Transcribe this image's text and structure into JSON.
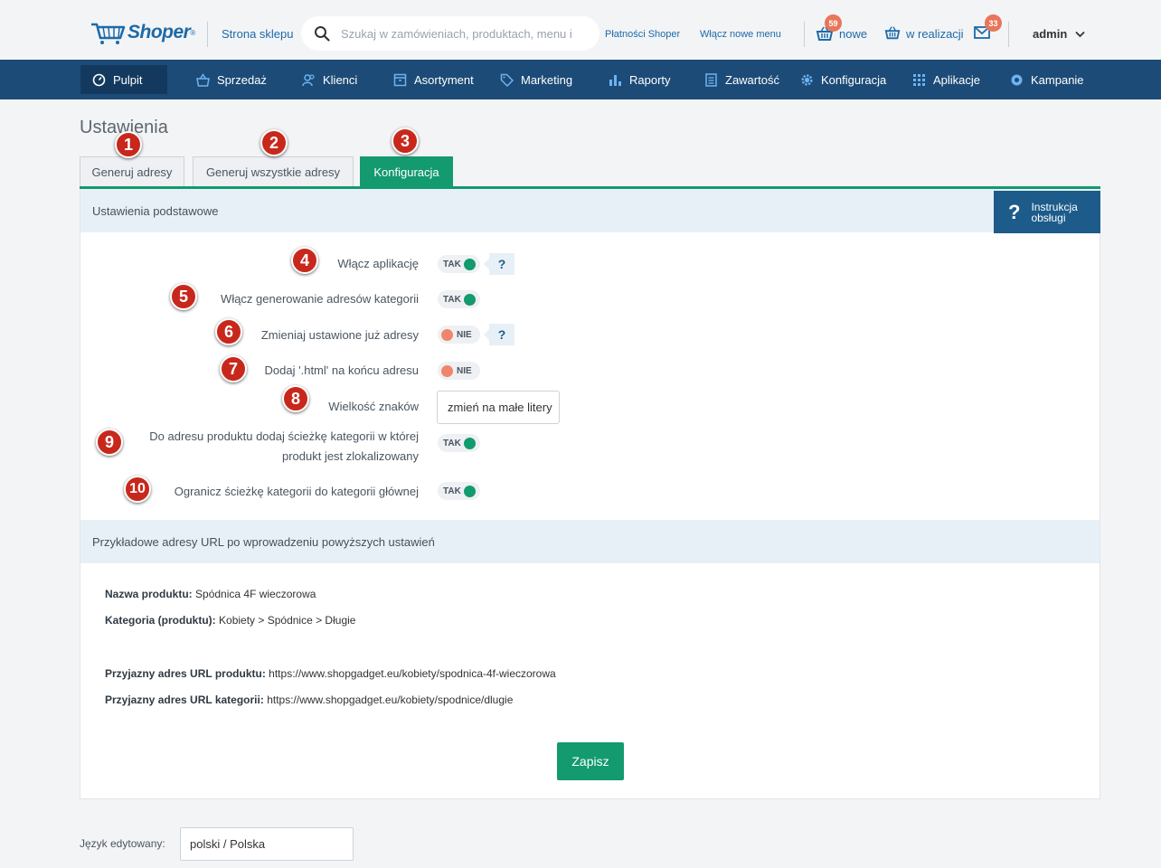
{
  "topbar": {
    "logo_text": "Shoper",
    "logo_reg": "®",
    "shop_link": "Strona sklepu",
    "search_placeholder": "Szukaj w zamówieniach, produktach, menu i",
    "payments_link": "Płatności Shoper",
    "new_menu_link": "Włącz nowe menu",
    "orders_new_count": "59",
    "orders_new_label": "nowe",
    "orders_progress_label": "w realizacji",
    "messages_count": "33",
    "user": "admin"
  },
  "nav": {
    "items": [
      {
        "label": "Pulpit",
        "icon": "dashboard-icon"
      },
      {
        "label": "Sprzedaż",
        "icon": "basket-icon"
      },
      {
        "label": "Klienci",
        "icon": "users-icon"
      },
      {
        "label": "Asortyment",
        "icon": "box-icon"
      },
      {
        "label": "Marketing",
        "icon": "tag-icon"
      },
      {
        "label": "Raporty",
        "icon": "chart-icon"
      },
      {
        "label": "Zawartość",
        "icon": "document-icon"
      },
      {
        "label": "Konfiguracja",
        "icon": "gear-icon"
      },
      {
        "label": "Aplikacje",
        "icon": "grid-icon"
      },
      {
        "label": "Kampanie",
        "icon": "campaign-icon"
      }
    ]
  },
  "page": {
    "title": "Ustawienia",
    "tabs": [
      "Generuj adresy",
      "Generuj wszystkie adresy",
      "Konfiguracja"
    ],
    "active_tab": "Konfiguracja"
  },
  "basic": {
    "header": "Ustawienia podstawowe",
    "help_line1": "Instrukcja",
    "help_line2": "obsługi",
    "help_q": "?",
    "rows": [
      {
        "label": "Włącz aplikację",
        "value": "TAK",
        "help": "?"
      },
      {
        "label": "Włącz generowanie adresów kategorii",
        "value": "TAK"
      },
      {
        "label": "Zmieniaj ustawione już adresy",
        "value": "NIE",
        "help": "?"
      },
      {
        "label": "Dodaj '.html' na końcu adresu",
        "value": "NIE"
      },
      {
        "label": "Wielkość znaków",
        "value": "zmień na małe litery"
      },
      {
        "label_line1": "Do adresu produktu dodaj ścieżkę kategorii w której",
        "label_line2": "produkt jest zlokalizowany",
        "value": "TAK"
      },
      {
        "label": "Ogranicz ścieżkę kategorii do kategorii głównej",
        "value": "TAK"
      }
    ]
  },
  "examples": {
    "header": "Przykładowe adresy URL po wprowadzeniu powyższych ustawień",
    "product_name_label": "Nazwa produktu:",
    "product_name": "Spódnica 4F wieczorowa",
    "category_label": "Kategoria (produktu):",
    "category": "Kobiety > Spódnice > Długie",
    "product_url_label": "Przyjazny adres URL produktu:",
    "product_url": "https://www.shopgadget.eu/kobiety/spodnica-4f-wieczorowa",
    "category_url_label": "Przyjazny adres URL kategorii:",
    "category_url": "https://www.shopgadget.eu/kobiety/spodnice/dlugie"
  },
  "save_label": "Zapisz",
  "language": {
    "label": "Język edytowany:",
    "value": "polski / Polska"
  },
  "markers": [
    "1",
    "2",
    "3",
    "4",
    "5",
    "6",
    "7",
    "8",
    "9",
    "10"
  ],
  "colors": {
    "primary_blue": "#1c4b77",
    "accent_green": "#139a6e",
    "marker_red": "#c8281c",
    "badge_orange": "#e8765a"
  }
}
